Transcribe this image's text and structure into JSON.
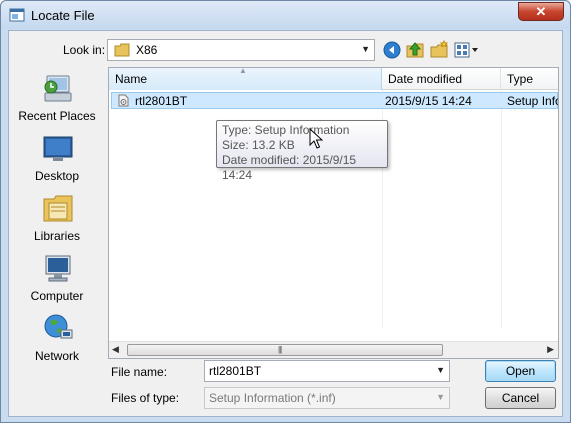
{
  "window": {
    "title": "Locate File",
    "close_glyph": "✕"
  },
  "toolbar": {
    "look_in_label": "Look in:",
    "look_in_value": "X86",
    "icons": [
      "back-icon",
      "up-folder-icon",
      "new-folder-icon",
      "view-menu-icon"
    ]
  },
  "places": [
    {
      "label": "Recent Places",
      "icon": "recent-places-icon"
    },
    {
      "label": "Desktop",
      "icon": "desktop-icon"
    },
    {
      "label": "Libraries",
      "icon": "libraries-icon"
    },
    {
      "label": "Computer",
      "icon": "computer-icon"
    },
    {
      "label": "Network",
      "icon": "network-icon"
    }
  ],
  "file_list": {
    "columns": [
      "Name",
      "Date modified",
      "Type"
    ],
    "rows": [
      {
        "name": "rtl2801BT",
        "date": "2015/9/15 14:24",
        "type": "Setup Info"
      }
    ],
    "tooltip": {
      "type": "Type: Setup Information",
      "size": "Size: 13.2 KB",
      "date": "Date modified: 2015/9/15 14:24"
    },
    "scroll_grip": "|||"
  },
  "form": {
    "file_name_label": "File name:",
    "file_name_value": "rtl2801BT",
    "file_type_label": "Files of type:",
    "file_type_value": "Setup Information (*.inf)"
  },
  "buttons": {
    "open": "Open",
    "cancel": "Cancel"
  },
  "colors": {
    "selection": "#cde8ff",
    "title_bar": "#c9dcf0",
    "close_button": "#c7452f"
  }
}
